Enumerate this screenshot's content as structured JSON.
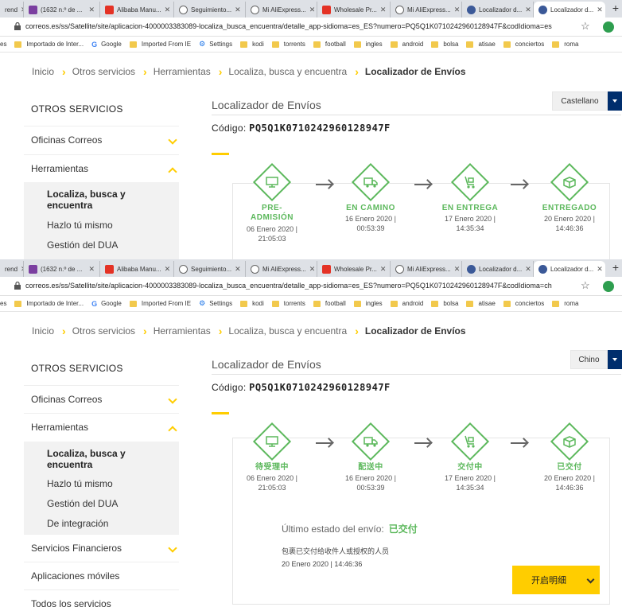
{
  "browser": {
    "tabs": [
      {
        "label": "rend",
        "icon": "page-icon"
      },
      {
        "label": "(1632 n.º de ...",
        "icon": "mail-icon"
      },
      {
        "label": "Alibaba Manu...",
        "icon": "aliexpress-icon"
      },
      {
        "label": "Seguimiento...",
        "icon": "globe-icon"
      },
      {
        "label": "Mi AliExpress...",
        "icon": "globe-icon"
      },
      {
        "label": "Wholesale Pr...",
        "icon": "aliexpress-icon"
      },
      {
        "label": "Mi AliExpress...",
        "icon": "globe-icon"
      },
      {
        "label": "Localizador d...",
        "icon": "correos-icon"
      },
      {
        "label": "Localizador d...",
        "icon": "correos-icon",
        "active": true
      }
    ],
    "url_es": "correos.es/ss/Satellite/site/aplicacion-4000003383089-localiza_busca_encuentra/detalle_app-sidioma=es_ES?numero=PQ5Q1K0710242960128947F&codIdioma=es",
    "url_ch": "correos.es/ss/Satellite/site/aplicacion-4000003383089-localiza_busca_encuentra/detalle_app-sidioma=es_ES?numero=PQ5Q1K0710242960128947F&codIdioma=ch",
    "bookmarks": [
      {
        "label": "es",
        "icon": "none"
      },
      {
        "label": "Importado de Inter...",
        "icon": "folder-icon"
      },
      {
        "label": "Google",
        "icon": "google-icon"
      },
      {
        "label": "Imported From IE",
        "icon": "folder-icon"
      },
      {
        "label": "Settings",
        "icon": "gear-icon"
      },
      {
        "label": "kodi",
        "icon": "folder-icon"
      },
      {
        "label": "torrents",
        "icon": "folder-icon"
      },
      {
        "label": "football",
        "icon": "folder-icon"
      },
      {
        "label": "ingles",
        "icon": "folder-icon"
      },
      {
        "label": "android",
        "icon": "folder-icon"
      },
      {
        "label": "bolsa",
        "icon": "folder-icon"
      },
      {
        "label": "atisae",
        "icon": "folder-icon"
      },
      {
        "label": "conciertos",
        "icon": "folder-icon"
      },
      {
        "label": "roma",
        "icon": "folder-icon"
      }
    ]
  },
  "breadcrumb": {
    "items": [
      "Inicio",
      "Otros servicios",
      "Herramientas",
      "Localiza, busca y encuentra"
    ],
    "current": "Localizador de Envíos"
  },
  "sidebar": {
    "title": "OTROS SERVICIOS",
    "oficinas": "Oficinas Correos",
    "herramientas": "Herramientas",
    "sub": [
      "Localiza, busca y",
      "encuentra",
      "Hazlo tú mismo",
      "Gestión del DUA",
      "De integración"
    ],
    "financieros": "Servicios Financieros",
    "moviles": "Aplicaciones móviles",
    "todos": "Todos los servicios"
  },
  "main": {
    "title": "Localizador de Envíos",
    "code_label": "Código:",
    "code_value": "PQ5Q1K0710242960128947F",
    "lang_es": "Castellano",
    "lang_ch": "Chino"
  },
  "steps_es": [
    {
      "label1": "PRE-",
      "label2": "ADMISIÓN",
      "date": "06 Enero 2020 |",
      "time": "21:05:03",
      "icon": "monitor-icon"
    },
    {
      "label1": "EN CAMINO",
      "date": "16 Enero 2020 |",
      "time": "00:53:39",
      "icon": "truck-icon"
    },
    {
      "label1": "EN ENTREGA",
      "date": "17 Enero 2020 |",
      "time": "14:35:34",
      "icon": "cart-icon"
    },
    {
      "label1": "ENTREGADO",
      "date": "20 Enero 2020 |",
      "time": "14:46:36",
      "icon": "box-icon"
    }
  ],
  "steps_ch": [
    {
      "label1": "待受理中",
      "date": "06 Enero 2020 |",
      "time": "21:05:03",
      "icon": "monitor-icon"
    },
    {
      "label1": "配送中",
      "date": "16 Enero 2020 |",
      "time": "00:53:39",
      "icon": "truck-icon"
    },
    {
      "label1": "交付中",
      "date": "17 Enero 2020 |",
      "time": "14:35:34",
      "icon": "cart-icon"
    },
    {
      "label1": "已交付",
      "date": "20 Enero 2020 |",
      "time": "14:46:36",
      "icon": "box-icon"
    }
  ],
  "status": {
    "label": "Último estado del envío:",
    "value": "已交付",
    "detail": "包裹已交付给收件人或授权的人员",
    "date": "20 Enero 2020 | 14:46:36",
    "details_button": "开启明细"
  },
  "colors": {
    "accent_yellow": "#ffcd00",
    "navy": "#002e6d",
    "green": "#5cb85c"
  }
}
